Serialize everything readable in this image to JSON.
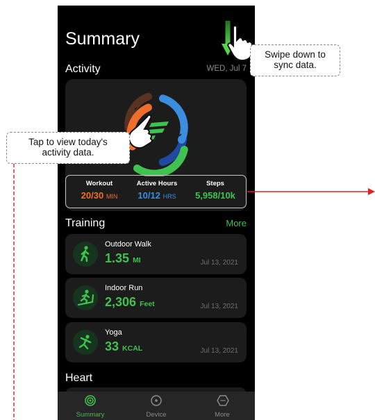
{
  "header": {
    "title": "Summary"
  },
  "activity": {
    "section_title": "Activity",
    "date": "WED, Jul 7",
    "stats": [
      {
        "label": "Workout",
        "value": "20/30",
        "unit": "MIN",
        "color": "#f06d2c"
      },
      {
        "label": "Active Hours",
        "value": "10/12",
        "unit": "HRS",
        "color": "#3b8de0"
      },
      {
        "label": "Steps",
        "value": "5,958/10k",
        "unit": "",
        "color": "#3fc24f"
      }
    ]
  },
  "training": {
    "section_title": "Training",
    "more_label": "More",
    "items": [
      {
        "name": "Outdoor Walk",
        "value": "1.35",
        "unit": "MI",
        "date": "Jul 13, 2021",
        "icon": "walking-person-icon"
      },
      {
        "name": "Indoor Run",
        "value": "2,306",
        "unit": "Feet",
        "date": "Jul 13, 2021",
        "icon": "treadmill-run-icon"
      },
      {
        "name": "Yoga",
        "value": "33",
        "unit": "KCAL",
        "date": "Jul 13, 2021",
        "icon": "yoga-pose-icon"
      }
    ]
  },
  "heart": {
    "section_title": "Heart"
  },
  "tabbar": {
    "tabs": [
      {
        "label": "Summary",
        "icon": "summary-icon",
        "active": true
      },
      {
        "label": "Device",
        "icon": "device-icon",
        "active": false
      },
      {
        "label": "More",
        "icon": "more-icon",
        "active": false
      }
    ]
  },
  "callouts": {
    "swipe": {
      "line1": "Swipe down to",
      "line2": "sync data."
    },
    "tap": {
      "line1": "Tap to view today's",
      "line2": "activity data."
    }
  },
  "colors": {
    "accent": "#3fc24f",
    "workout": "#f06d2c",
    "active": "#3b8de0",
    "steps": "#3fc24f",
    "annotation": "#e02020"
  }
}
